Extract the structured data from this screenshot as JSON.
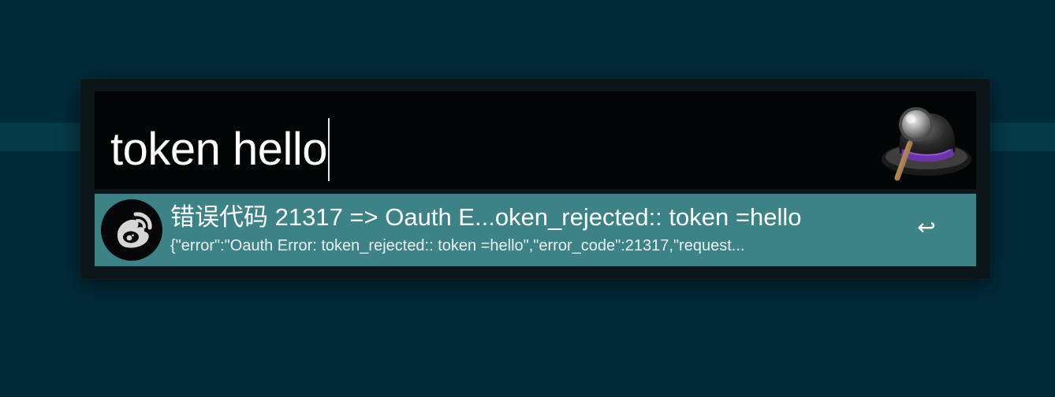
{
  "search": {
    "query": "token hello"
  },
  "app": {
    "icon": "alfred-hat-magnifier-icon"
  },
  "results": [
    {
      "icon": "weibo-icon",
      "title": "错误代码 21317 => Oauth E...oken_rejected:: token =hello",
      "subtitle": "{\"error\":\"Oauth Error: token_rejected:: token =hello\",\"error_code\":21317,\"request...",
      "action_icon": "return-key-icon",
      "action_glyph": "↩"
    }
  ],
  "colors": {
    "desktop": "#012a38",
    "panel": "#0c1518",
    "search_area": "#010506",
    "selected_row": "#3c8286"
  }
}
